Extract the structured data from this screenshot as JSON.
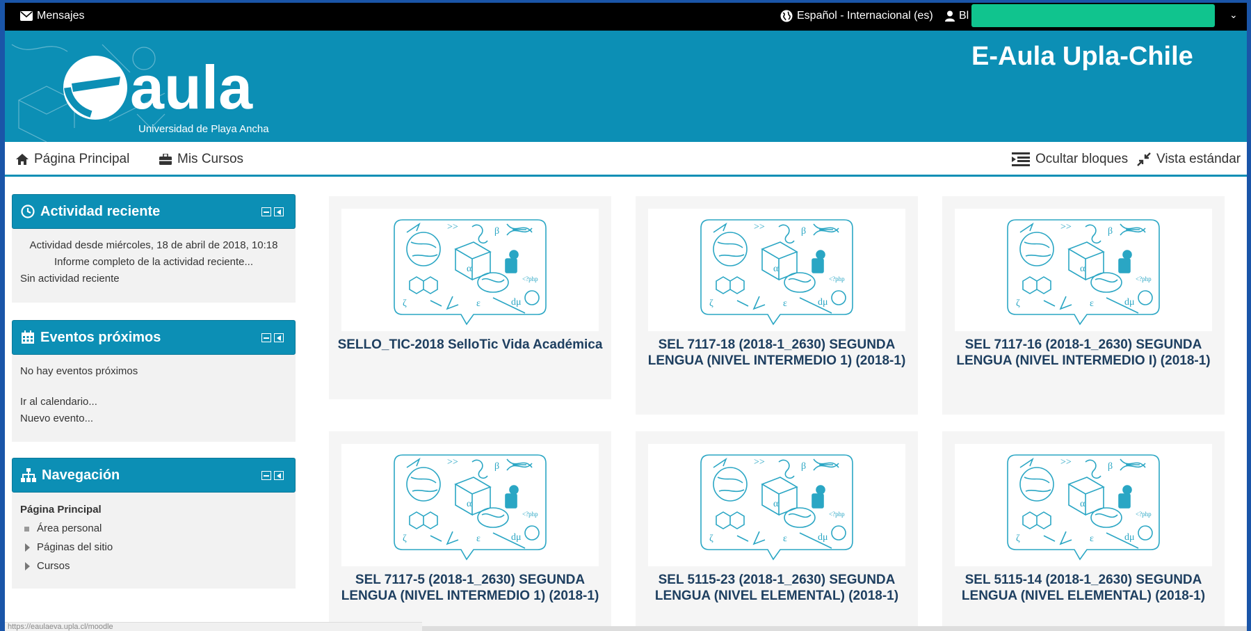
{
  "topbar": {
    "messages": "Mensajes",
    "language": "Español - Internacional (es)",
    "user_partial": "Bl"
  },
  "header": {
    "site_title": "E-Aula Upla-Chile",
    "logo_text": "aula",
    "logo_subtitle": "Universidad de Playa Ancha"
  },
  "navbar": {
    "home": "Página Principal",
    "my_courses": "Mis Cursos",
    "hide_blocks": "Ocultar bloques",
    "standard_view": "Vista estándar"
  },
  "blocks": {
    "recent": {
      "title": "Actividad reciente",
      "since": "Actividad desde miércoles, 18 de abril de 2018, 10:18",
      "full_report": "Informe completo de la actividad reciente...",
      "none": "Sin actividad reciente"
    },
    "events": {
      "title": "Eventos próximos",
      "none": "No hay eventos próximos",
      "calendar": "Ir al calendario...",
      "new_event": "Nuevo evento..."
    },
    "navigation": {
      "title": "Navegación",
      "root": "Página Principal",
      "items": [
        "Área personal",
        "Páginas del sitio",
        "Cursos"
      ]
    }
  },
  "courses": [
    "SELLO_TIC-2018 SelloTic Vida Académica",
    "SEL 7117-18 (2018-1_2630) SEGUNDA LENGUA (NIVEL INTERMEDIO 1) (2018-1)",
    "SEL 7117-16 (2018-1_2630) SEGUNDA LENGUA (NIVEL INTERMEDIO I) (2018-1)",
    "SEL 7117-5 (2018-1_2630) SEGUNDA LENGUA (NIVEL INTERMEDIO 1) (2018-1)",
    "SEL 5115-23 (2018-1_2630) SEGUNDA LENGUA (NIVEL ELEMENTAL) (2018-1)",
    "SEL 5115-14 (2018-1_2630) SEGUNDA LENGUA (NIVEL ELEMENTAL) (2018-1)"
  ],
  "status_url": "https://eaulaeva.upla.cl/moodle",
  "colors": {
    "brand": "#0c8fb5",
    "topbar": "#000000",
    "course_title": "#1e3f60",
    "redaction": "#10c48e"
  }
}
